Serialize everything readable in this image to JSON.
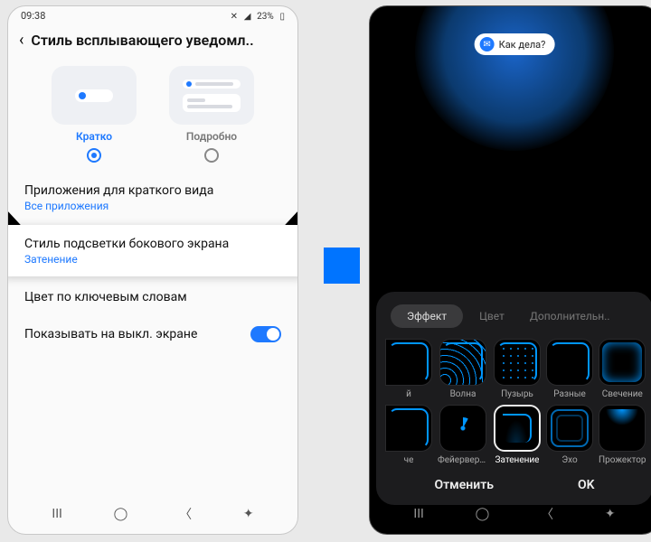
{
  "left": {
    "status": {
      "time": "09:38",
      "battery": "23%"
    },
    "title": "Стиль всплывающего уведомл..",
    "styles": {
      "brief": "Кратко",
      "detail": "Подробно"
    },
    "items": {
      "apps": {
        "t": "Приложения для краткого вида",
        "s": "Все приложения"
      },
      "edge": {
        "t": "Стиль подсветки бокового экрана",
        "s": "Затенение"
      },
      "color": {
        "t": "Цвет по ключевым словам"
      },
      "aod": {
        "t": "Показывать на выкл. экране"
      }
    }
  },
  "right": {
    "bubble": "Как дела?",
    "tabs": {
      "effect": "Эффект",
      "color": "Цвет",
      "more": "Дополнительн.."
    },
    "effects": [
      "й",
      "Волна",
      "Пузырь",
      "Разные",
      "Свечение",
      "че",
      "Фейерверки",
      "Затенение",
      "Эхо",
      "Прожектор"
    ],
    "selected": "Затенение",
    "actions": {
      "cancel": "Отменить",
      "ok": "OK"
    }
  }
}
